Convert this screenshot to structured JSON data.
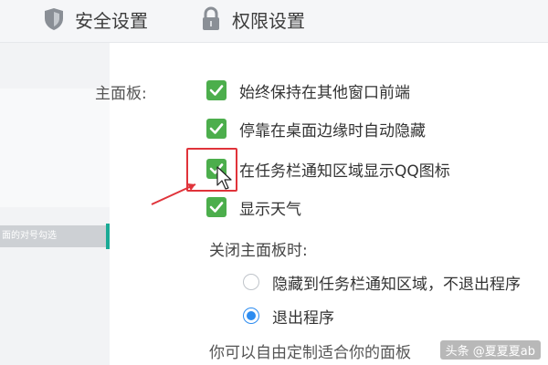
{
  "tabs": {
    "security": {
      "label": "安全设置",
      "icon": "shield-icon"
    },
    "permission": {
      "label": "权限设置",
      "icon": "lock-icon"
    }
  },
  "sidebar": {
    "tooltip": "面的对号勾选"
  },
  "main_panel": {
    "label": "主面板:",
    "options": [
      {
        "label": "始终保持在其他窗口前端",
        "checked": true
      },
      {
        "label": "停靠在桌面边缘时自动隐藏",
        "checked": true
      },
      {
        "label": "在任务栏通知区域显示QQ图标",
        "checked": true
      },
      {
        "label": "显示天气",
        "checked": true
      }
    ]
  },
  "close_behavior": {
    "label": "关闭主面板时:",
    "options": [
      {
        "label": "隐藏到任务栏通知区域，不退出程序",
        "selected": false
      },
      {
        "label": "退出程序",
        "selected": true
      }
    ]
  },
  "footer_text": "你可以自由定制适合你的面板",
  "watermark": "头条 @夏夏夏ab",
  "colors": {
    "checkbox": "#4cae4c",
    "radio_selected": "#2d8cf0",
    "highlight": "#e0333a",
    "sidebar_accent": "#1aaa95"
  }
}
